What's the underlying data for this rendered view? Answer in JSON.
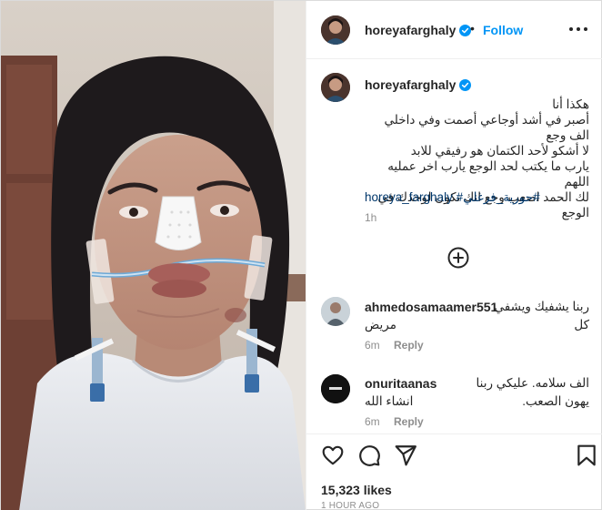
{
  "post": {
    "username": "horeyafarghaly",
    "verified": true,
    "follow_label": "Follow",
    "separator": "•"
  },
  "caption": {
    "username": "horeyafarghaly",
    "lines": [
      "هكذا أنا",
      "أصبر في أشد أوجاعي أصمت وفي داخلي الف وجع",
      "لا أشكو لأحد الكتمان هو رفيقي للابد",
      "يارب ما يكتب لحد الوجع يارب  اخر عمليه اللهم",
      "لك الحمد  اصعب وجع انك تكون لوحدك في الوجع",
      ""
    ],
    "hashtags": "horeya_farghaly #حورية_فرغلي#",
    "time": "1h"
  },
  "comments": [
    {
      "username": "ahmedosamaamer551",
      "text_inline": "ربنا يشفيك ويشفي كل",
      "text_line2": "مريض",
      "time": "6m",
      "reply_label": "Reply"
    },
    {
      "username": "onuritaanas",
      "text_inline": "الف سلامه. عليكي ربنا يهون الصعب.",
      "text_line2": "انشاء الله",
      "time": "6m",
      "reply_label": "Reply"
    }
  ],
  "engagement": {
    "likes": "15,323 likes",
    "posted_ago": "1 HOUR AGO"
  },
  "icons": {
    "verified": "verified-badge-icon",
    "more": "more-options-icon",
    "load_more": "plus-circle-icon",
    "like": "heart-icon",
    "comment": "comment-bubble-icon",
    "share": "paper-plane-icon",
    "save": "bookmark-icon"
  },
  "colors": {
    "accent": "#0095f6",
    "hashtag": "#00376b",
    "text": "#262626",
    "muted": "#8e8e8e"
  }
}
